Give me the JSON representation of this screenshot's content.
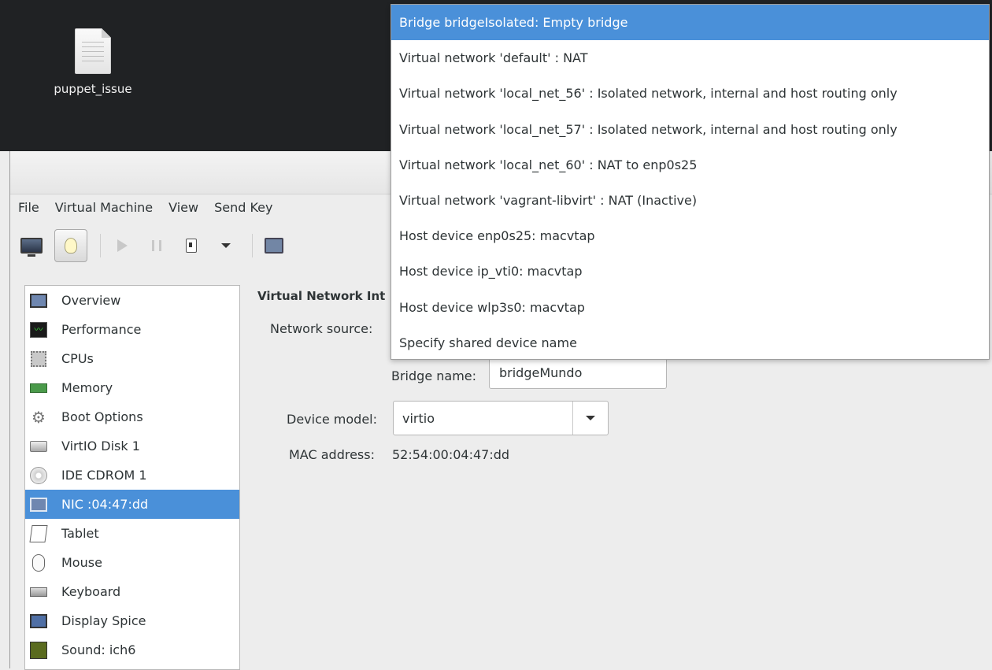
{
  "desktop": {
    "icon_label": "puppet_issue"
  },
  "menu": {
    "items": [
      "File",
      "Virtual Machine",
      "View",
      "Send Key"
    ]
  },
  "sidebar": {
    "items": [
      {
        "label": "Overview",
        "icon": "monitor-icon"
      },
      {
        "label": "Performance",
        "icon": "performance-icon"
      },
      {
        "label": "CPUs",
        "icon": "cpu-icon"
      },
      {
        "label": "Memory",
        "icon": "memory-icon"
      },
      {
        "label": "Boot Options",
        "icon": "gears-icon"
      },
      {
        "label": "VirtIO Disk 1",
        "icon": "disk-icon"
      },
      {
        "label": "IDE CDROM 1",
        "icon": "cdrom-icon"
      },
      {
        "label": "NIC :04:47:dd",
        "icon": "nic-icon"
      },
      {
        "label": "Tablet",
        "icon": "tablet-icon"
      },
      {
        "label": "Mouse",
        "icon": "mouse-icon"
      },
      {
        "label": "Keyboard",
        "icon": "keyboard-icon"
      },
      {
        "label": "Display Spice",
        "icon": "display-icon"
      },
      {
        "label": "Sound: ich6",
        "icon": "sound-icon"
      }
    ],
    "selected_index": 7
  },
  "details": {
    "section_title": "Virtual Network Int",
    "network_source_label": "Network source:",
    "bridge_name_label": "Bridge name:",
    "bridge_name_value": "bridgeMundo",
    "device_model_label": "Device model:",
    "device_model_value": "virtio",
    "mac_label": "MAC address:",
    "mac_value": "52:54:00:04:47:dd"
  },
  "dropdown": {
    "options": [
      "Bridge bridgeIsolated: Empty bridge",
      "Virtual network 'default' : NAT",
      "Virtual network 'local_net_56' : Isolated network, internal and host routing only",
      "Virtual network 'local_net_57' : Isolated network, internal and host routing only",
      "Virtual network 'local_net_60' : NAT to enp0s25",
      "Virtual network 'vagrant-libvirt' : NAT (Inactive)",
      "Host device enp0s25: macvtap",
      "Host device ip_vti0: macvtap",
      "Host device wlp3s0: macvtap",
      "Specify shared device name"
    ],
    "highlighted_index": 0
  },
  "colors": {
    "selection": "#4a90d9",
    "desktop": "#202224"
  }
}
